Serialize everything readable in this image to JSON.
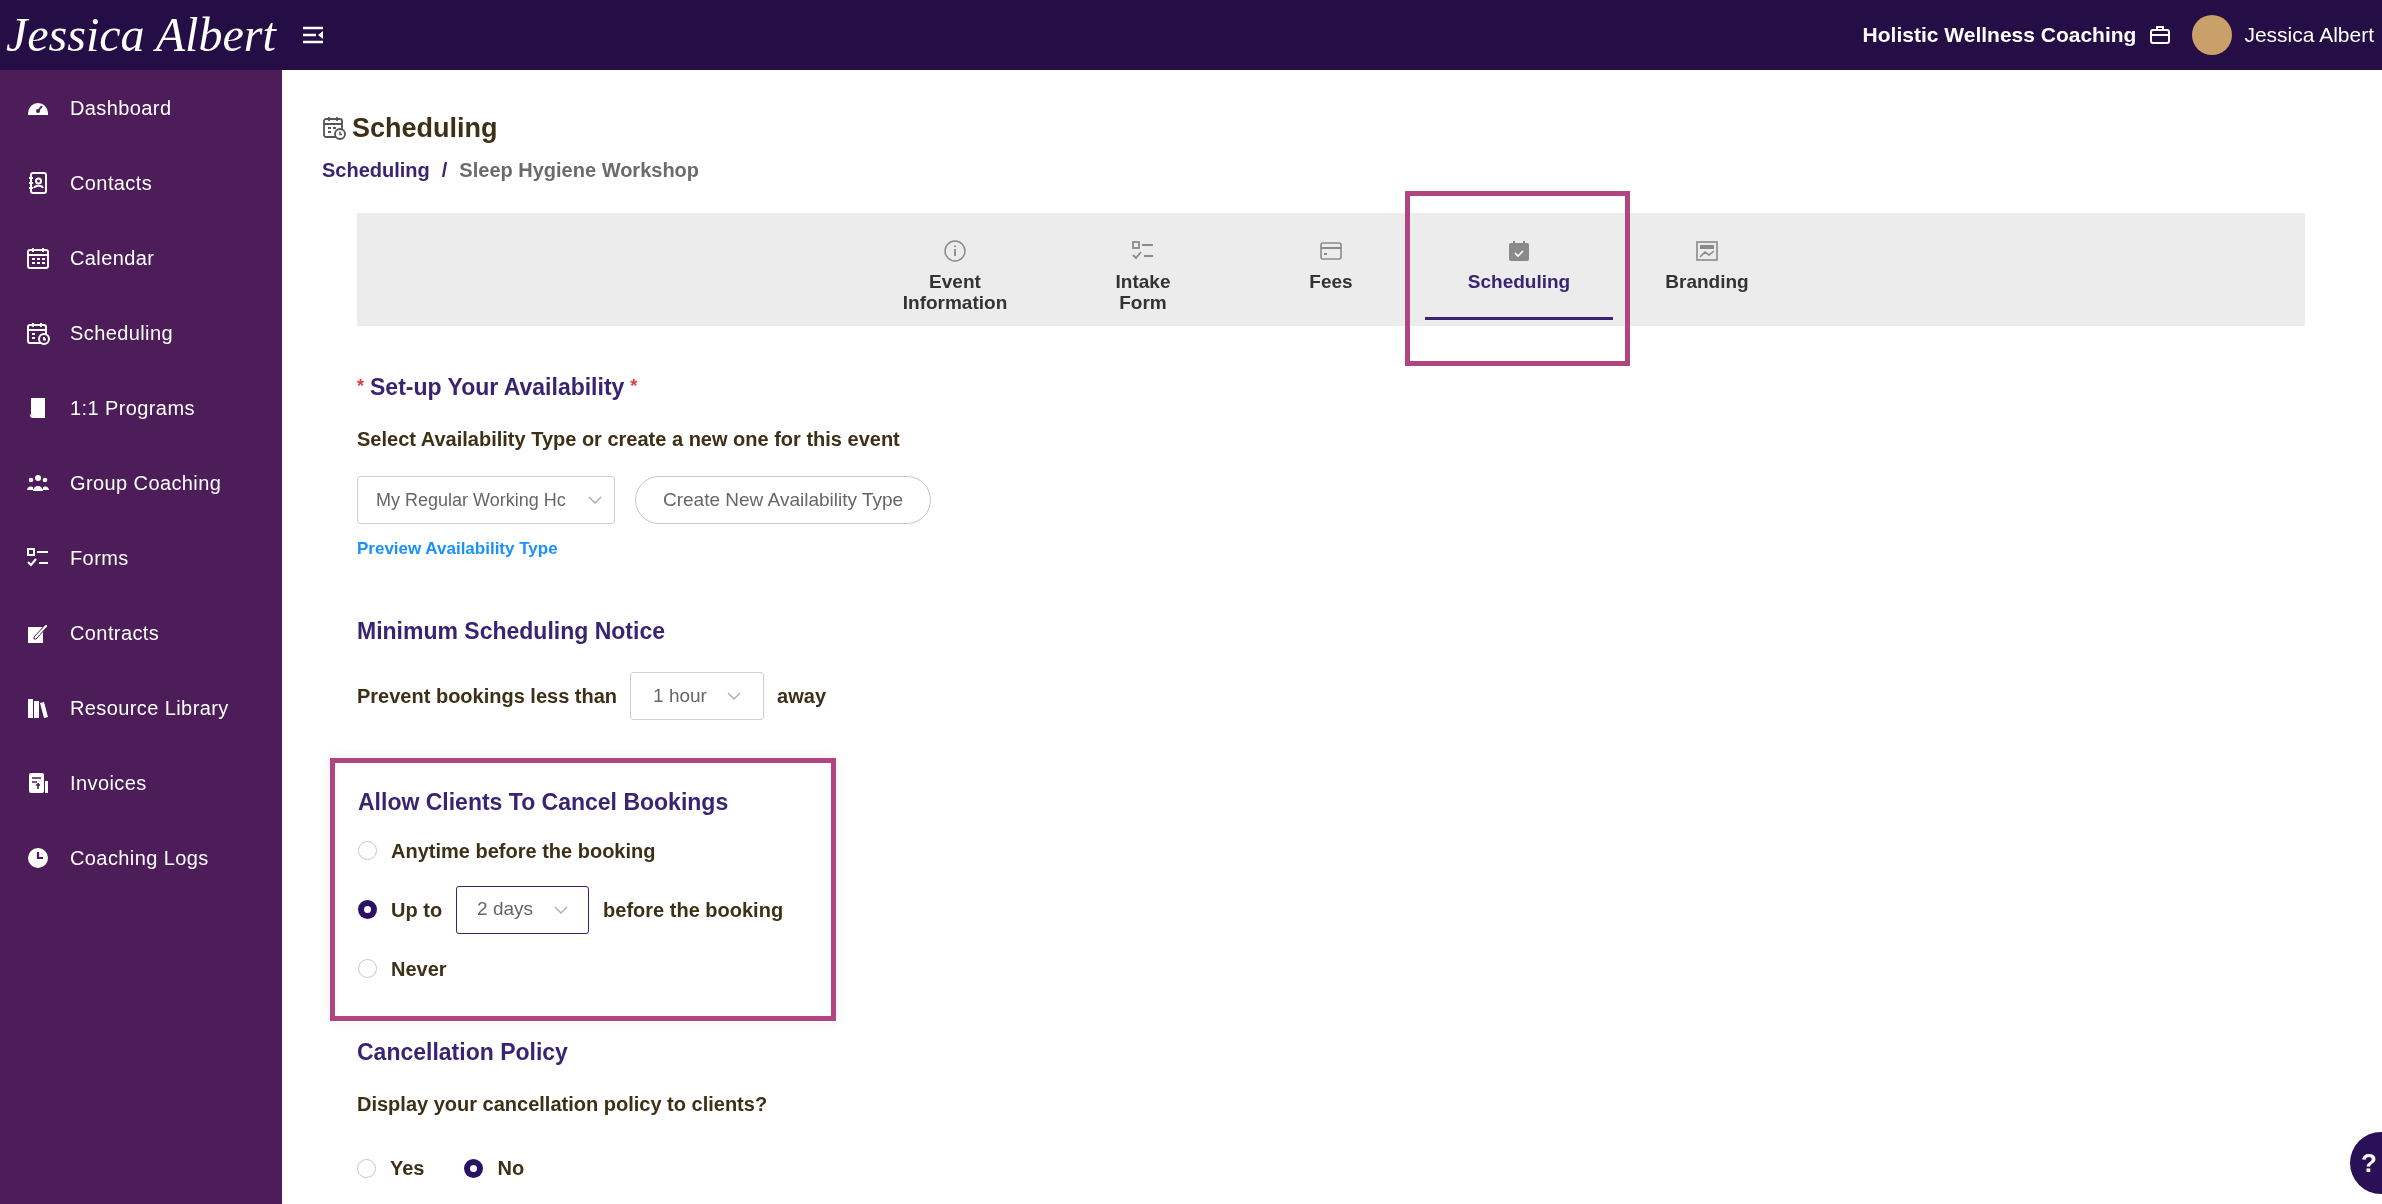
{
  "header": {
    "logo": "Jessica Albert",
    "business": "Holistic Wellness Coaching",
    "user": "Jessica Albert"
  },
  "sidebar": {
    "items": [
      {
        "label": "Dashboard",
        "kind": "dashboard"
      },
      {
        "label": "Contacts",
        "kind": "contacts"
      },
      {
        "label": "Calendar",
        "kind": "calendar"
      },
      {
        "label": "Scheduling",
        "kind": "scheduling"
      },
      {
        "label": "1:1 Programs",
        "kind": "book"
      },
      {
        "label": "Group Coaching",
        "kind": "group"
      },
      {
        "label": "Forms",
        "kind": "forms"
      },
      {
        "label": "Contracts",
        "kind": "contracts"
      },
      {
        "label": "Resource Library",
        "kind": "library"
      },
      {
        "label": "Invoices",
        "kind": "invoices"
      },
      {
        "label": "Coaching Logs",
        "kind": "clock"
      }
    ]
  },
  "page": {
    "title": "Scheduling",
    "breadcrumb": [
      {
        "label": "Scheduling",
        "link": true
      },
      {
        "label": "Sleep Hygiene Workshop",
        "link": false
      }
    ],
    "separator": "/"
  },
  "tabs": [
    {
      "label": "Event Information",
      "kind": "info",
      "selected": false,
      "highlighted": false
    },
    {
      "label": "Intake Form",
      "kind": "checklist",
      "selected": false,
      "highlighted": false
    },
    {
      "label": "Fees",
      "kind": "card",
      "selected": false,
      "highlighted": false
    },
    {
      "label": "Scheduling",
      "kind": "calendar",
      "selected": true,
      "highlighted": true
    },
    {
      "label": "Branding",
      "kind": "image",
      "selected": false,
      "highlighted": false
    }
  ],
  "availability": {
    "marker_before": "*",
    "heading": "Set-up Your Availability",
    "marker_after": "*",
    "prompt": "Select Availability Type or create a new one for this event",
    "select": "My Regular Working Hc",
    "create_button": "Create New Availability Type",
    "preview_link": "Preview Availability Type"
  },
  "notice": {
    "heading": "Minimum Scheduling Notice",
    "before": "Prevent bookings less than",
    "select": "1 hour",
    "after": "away"
  },
  "cancel": {
    "heading": "Allow Clients To Cancel Bookings",
    "highlighted": true,
    "options": [
      {
        "kind": "plain",
        "label": "Anytime before the booking",
        "selected": false
      },
      {
        "kind": "with_select",
        "label": "Up to",
        "select": "2 days",
        "focused": true,
        "after": "before the booking",
        "selected": true
      },
      {
        "kind": "plain",
        "label": "Never",
        "selected": false
      }
    ]
  },
  "policy": {
    "heading": "Cancellation Policy",
    "question": "Display your cancellation policy to clients?",
    "options": [
      {
        "label": "Yes",
        "selected": false
      },
      {
        "label": "No",
        "selected": true
      }
    ]
  },
  "help_button": "?"
}
